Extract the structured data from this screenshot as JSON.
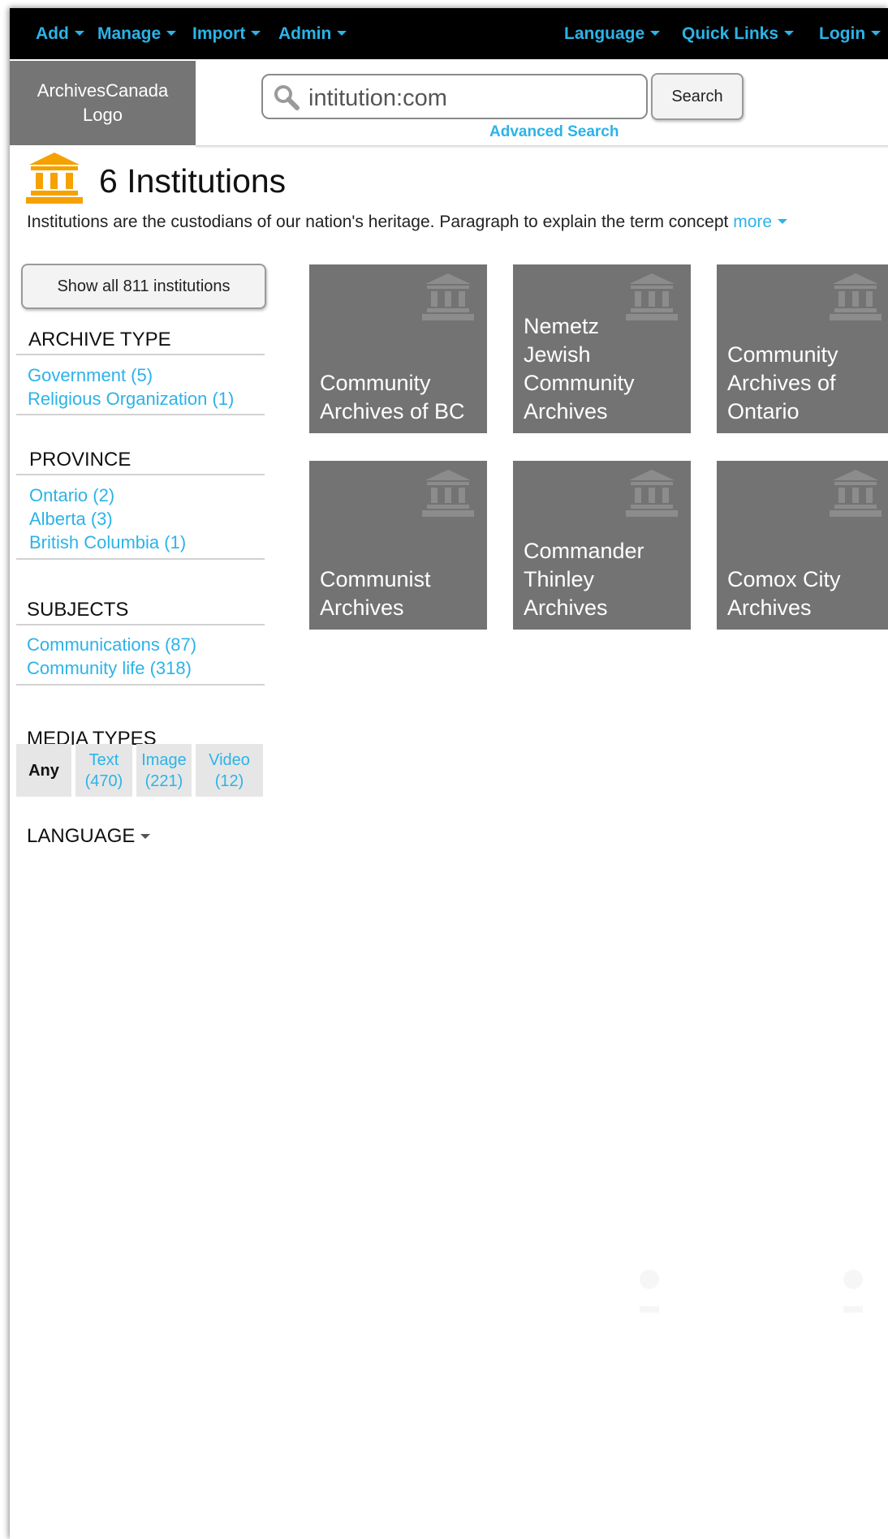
{
  "nav": {
    "left": [
      "Add",
      "Manage",
      "Import",
      "Admin"
    ],
    "right": [
      "Language",
      "Quick Links",
      "Login"
    ]
  },
  "header": {
    "logo_line1": "ArchivesCanada",
    "logo_line2": "Logo",
    "search_value": "intitution:com",
    "search_button": "Search",
    "advanced_search": "Advanced Search"
  },
  "title": {
    "count_text": "6 Institutions",
    "intro": "Institutions are the custodians of our nation's heritage. Paragraph to explain the term concept ",
    "more": "more"
  },
  "sidebar": {
    "show_all": "Show all 811 institutions",
    "archive_type": {
      "heading": "ARCHIVE TYPE",
      "items": [
        "Government (5)",
        "Religious Organization (1)"
      ]
    },
    "province": {
      "heading": "PROVINCE",
      "items": [
        "Ontario (2)",
        "Alberta (3)",
        "British Columbia (1)"
      ]
    },
    "subjects": {
      "heading": "SUBJECTS",
      "items": [
        "Communications (87)",
        "Community life (318)"
      ]
    },
    "media_types": {
      "heading": "MEDIA TYPES",
      "options": [
        {
          "label": "Any",
          "count": ""
        },
        {
          "label": "Text",
          "count": "(470)"
        },
        {
          "label": "Image",
          "count": "(221)"
        },
        {
          "label": "Video",
          "count": "(12)"
        }
      ],
      "selected": "Any"
    },
    "language_heading": "LANGUAGE"
  },
  "tiles": [
    {
      "lines": [
        "Community",
        "Archives of BC"
      ]
    },
    {
      "lines": [
        "Nemetz",
        "Jewish",
        "Community",
        "Archives"
      ]
    },
    {
      "lines": [
        "Community",
        "Archives of",
        "Ontario"
      ]
    },
    {
      "lines": [
        "Communist",
        "Archives"
      ]
    },
    {
      "lines": [
        "Commander",
        "Thinley",
        "Archives"
      ]
    },
    {
      "lines": [
        "Comox City",
        "Archives"
      ]
    }
  ],
  "icons": {
    "institution": "institution-icon",
    "search": "search-icon",
    "caret": "caret-down-icon"
  },
  "colors": {
    "link": "#2cb3e8",
    "accent_orange": "#f5a100",
    "tile": "#737373",
    "nav_bg": "#000000"
  }
}
